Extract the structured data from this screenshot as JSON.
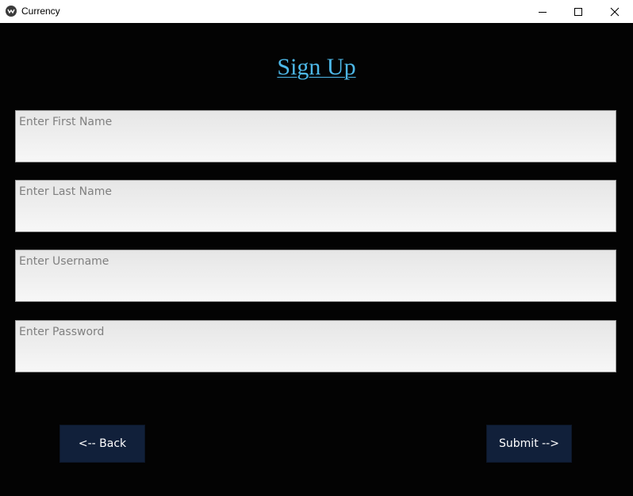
{
  "window": {
    "title": "Currency",
    "minimize_icon": "minimize-icon",
    "maximize_icon": "maximize-icon",
    "close_icon": "close-icon"
  },
  "form": {
    "heading": "Sign Up",
    "fields": [
      {
        "placeholder": "Enter First Name",
        "value": ""
      },
      {
        "placeholder": "Enter Last Name",
        "value": ""
      },
      {
        "placeholder": "Enter Username",
        "value": ""
      },
      {
        "placeholder": "Enter Password",
        "value": ""
      }
    ],
    "back_label": "<-- Back",
    "submit_label": "Submit -->"
  },
  "colors": {
    "background": "#030303",
    "heading": "#4db8e8",
    "button_bg": "#11203a",
    "field_bg": "#efefef",
    "placeholder": "#808080"
  }
}
